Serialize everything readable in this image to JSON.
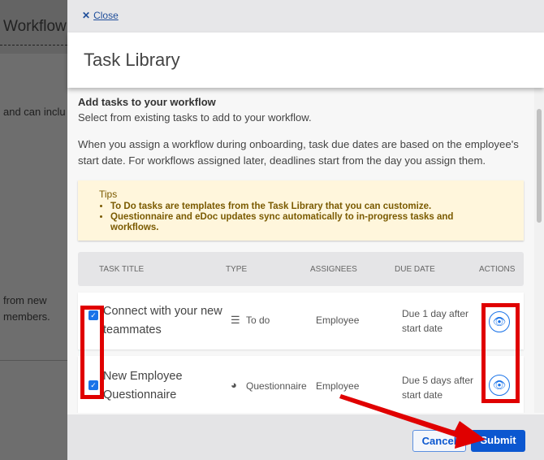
{
  "background": {
    "title": "Workflow",
    "text1": "and can inclu",
    "text2": "from new",
    "text3": "members."
  },
  "close_label": "Close",
  "title": "Task Library",
  "heading": "Add tasks to your workflow",
  "subheading": "Select from existing tasks to add to your workflow.",
  "description": "When you assign a workflow during onboarding, task due dates are based on the employee's start date. For workflows assigned later, deadlines start from the day you assign them.",
  "tips": {
    "title": "Tips",
    "items": [
      "To Do tasks are templates from the Task Library that you can customize.",
      "Questionnaire and eDoc updates sync automatically to in-progress tasks and workflows."
    ]
  },
  "table": {
    "columns": [
      "TASK TITLE",
      "TYPE",
      "ASSIGNEES",
      "DUE DATE",
      "ACTIONS"
    ],
    "rows": [
      {
        "checked": true,
        "title": "Connect with your new teammates",
        "type": "To do",
        "type_icon": "list-icon",
        "assignee": "Employee",
        "due": "Due 1 day after start date"
      },
      {
        "checked": true,
        "title": "New Employee Questionnaire",
        "type": "Questionnaire",
        "type_icon": "pie-chart-icon",
        "assignee": "Employee",
        "due": "Due 5 days after start date"
      }
    ]
  },
  "footer": {
    "cancel": "Cancel",
    "submit": "Submit"
  },
  "colors": {
    "primary": "#0b57d0",
    "annotation": "#e00000"
  }
}
